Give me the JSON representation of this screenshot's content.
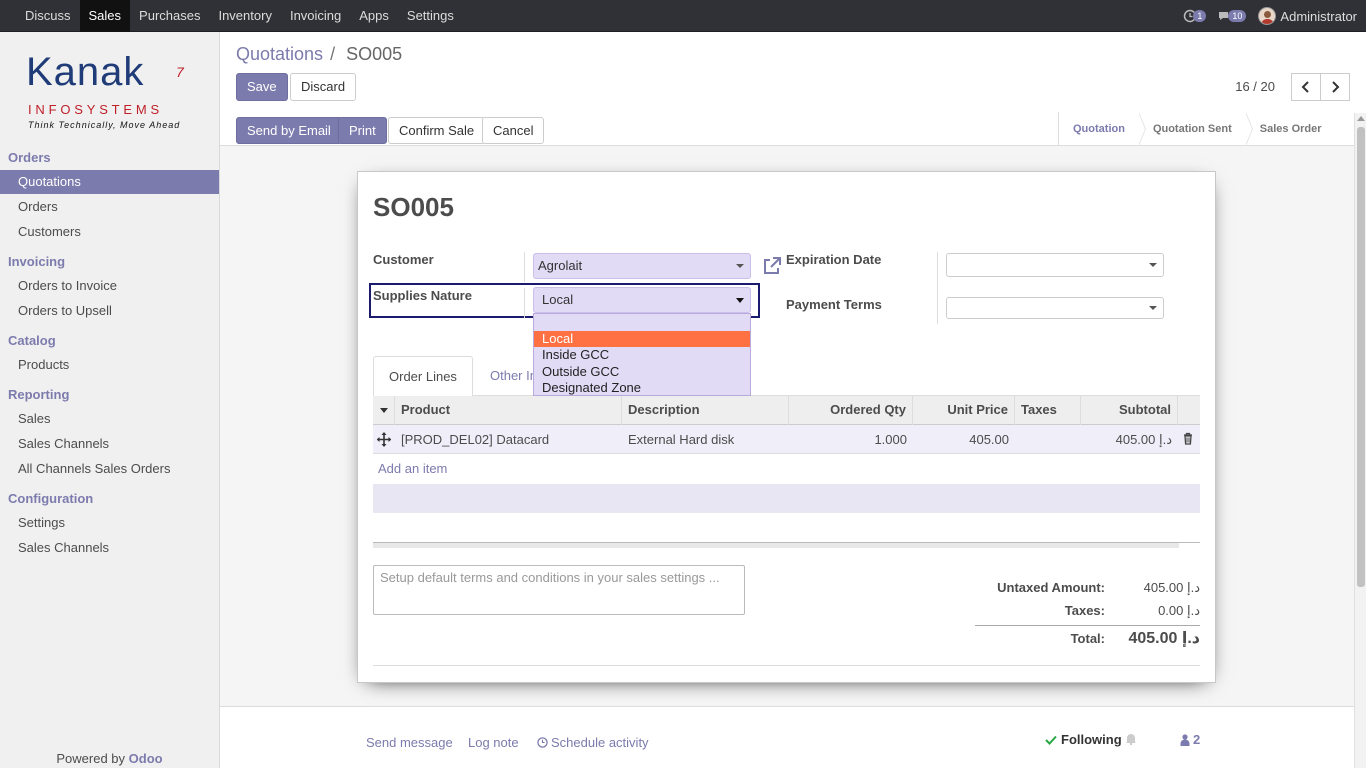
{
  "topbar": {
    "menus": [
      "Discuss",
      "Sales",
      "Purchases",
      "Inventory",
      "Invoicing",
      "Apps",
      "Settings"
    ],
    "active_menu": "Sales",
    "activity_count": "1",
    "message_count": "10",
    "user": "Administrator"
  },
  "logo": {
    "name": "Kanak",
    "mark": "7",
    "sub": "INFOSYSTEMS",
    "tagline": "Think Technically, Move Ahead"
  },
  "sidebar": {
    "sections": [
      {
        "title": "Orders",
        "items": [
          "Quotations",
          "Orders",
          "Customers"
        ]
      },
      {
        "title": "Invoicing",
        "items": [
          "Orders to Invoice",
          "Orders to Upsell"
        ]
      },
      {
        "title": "Catalog",
        "items": [
          "Products"
        ]
      },
      {
        "title": "Reporting",
        "items": [
          "Sales",
          "Sales Channels",
          "All Channels Sales Orders"
        ]
      },
      {
        "title": "Configuration",
        "items": [
          "Settings",
          "Sales Channels"
        ]
      }
    ],
    "active_item": "Quotations",
    "powered_by": "Powered by",
    "powered_brand": "Odoo"
  },
  "control_panel": {
    "breadcrumb_parent": "Quotations",
    "breadcrumb_sep": "/",
    "breadcrumb_current": "SO005",
    "save_label": "Save",
    "discard_label": "Discard",
    "pager": "16 / 20"
  },
  "actions": {
    "send_email": "Send by Email",
    "print": "Print",
    "confirm": "Confirm Sale",
    "cancel": "Cancel"
  },
  "statusbar": {
    "stages": [
      "Quotation",
      "Quotation Sent",
      "Sales Order"
    ],
    "active": "Quotation"
  },
  "form": {
    "title": "SO005",
    "customer_label": "Customer",
    "customer_value": "Agrolait",
    "supplies_label": "Supplies Nature",
    "supplies_value": "Local",
    "expiration_label": "Expiration Date",
    "expiration_value": "",
    "payment_terms_label": "Payment Terms",
    "payment_terms_value": "",
    "supplies_options": [
      "Local",
      "Inside GCC",
      "Outside GCC",
      "Designated Zone"
    ],
    "highlighted_option": "Local"
  },
  "tabs": [
    "Order Lines",
    "Other In"
  ],
  "lines": {
    "headers": [
      "Product",
      "Description",
      "Ordered Qty",
      "Unit Price",
      "Taxes",
      "Subtotal"
    ],
    "rows": [
      {
        "product": "[PROD_DEL02] Datacard",
        "description": "External Hard disk",
        "qty": "1.000",
        "unit_price": "405.00",
        "taxes": "",
        "subtotal": "405.00 د.إ"
      }
    ],
    "add_item": "Add an item"
  },
  "notes_placeholder": "Setup default terms and conditions in your sales settings ...",
  "totals": {
    "untaxed_label": "Untaxed Amount:",
    "untaxed_value": "405.00 د.إ",
    "taxes_label": "Taxes:",
    "taxes_value": "0.00 د.إ",
    "total_label": "Total:",
    "total_value": "405.00 د.إ"
  },
  "chatter": {
    "send_message": "Send message",
    "log_note": "Log note",
    "schedule_activity": "Schedule activity",
    "following": "Following",
    "followers": "2"
  },
  "colors": {
    "brand": "#7c7bad",
    "navbar": "#2f3136",
    "highlight": "#ff7043",
    "dropdown_bg": "#e1dbf6"
  }
}
